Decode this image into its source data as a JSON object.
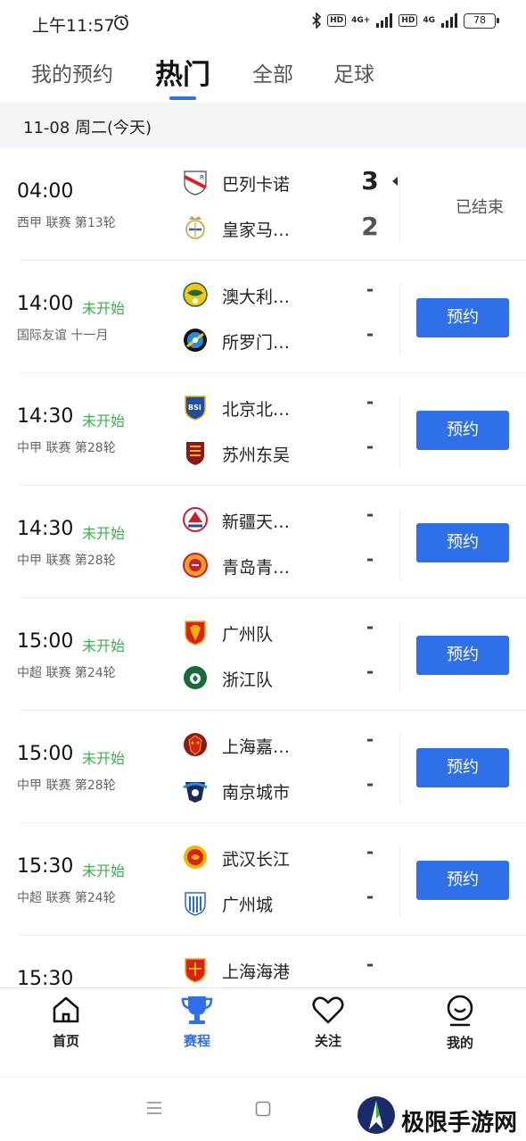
{
  "status_bar": {
    "time": "上午11:57",
    "net1": "4G+",
    "net2": "4G",
    "hd": "HD",
    "battery": "78"
  },
  "tabs": [
    {
      "label": "我的预约",
      "active": false
    },
    {
      "label": "热门",
      "active": true
    },
    {
      "label": "全部",
      "active": false
    },
    {
      "label": "足球",
      "active": false
    }
  ],
  "date_header": "11-08 周二(今天)",
  "matches": [
    {
      "time": "04:00",
      "state": "",
      "league": "西甲 联赛  第13轮",
      "home": "巴列卡诺",
      "away": "皇家马…",
      "home_score": "3",
      "away_score": "2",
      "action": "已结束",
      "home_logo": "rayo-logo",
      "away_logo": "real-madrid-logo"
    },
    {
      "time": "14:00",
      "state": "未开始",
      "league": "国际友谊 十一月",
      "home": "澳大利…",
      "away": "所罗门…",
      "home_score": "-",
      "away_score": "-",
      "action": "预约",
      "home_logo": "australia-logo",
      "away_logo": "solomon-logo"
    },
    {
      "time": "14:30",
      "state": "未开始",
      "league": "中甲 联赛  第28轮",
      "home": "北京北…",
      "away": "苏州东吴",
      "home_score": "-",
      "away_score": "-",
      "action": "预约",
      "home_logo": "beijing-logo",
      "away_logo": "suzhou-logo"
    },
    {
      "time": "14:30",
      "state": "未开始",
      "league": "中甲 联赛  第28轮",
      "home": "新疆天…",
      "away": "青岛青…",
      "home_score": "-",
      "away_score": "-",
      "action": "预约",
      "home_logo": "xinjiang-logo",
      "away_logo": "qingdao-logo"
    },
    {
      "time": "15:00",
      "state": "未开始",
      "league": "中超 联赛  第24轮",
      "home": "广州队",
      "away": "浙江队",
      "home_score": "-",
      "away_score": "-",
      "action": "预约",
      "home_logo": "guangzhou-logo",
      "away_logo": "zhejiang-logo"
    },
    {
      "time": "15:00",
      "state": "未开始",
      "league": "中甲 联赛  第28轮",
      "home": "上海嘉…",
      "away": "南京城市",
      "home_score": "-",
      "away_score": "-",
      "action": "预约",
      "home_logo": "shanghai-jiading-logo",
      "away_logo": "nanjing-logo"
    },
    {
      "time": "15:30",
      "state": "未开始",
      "league": "中超 联赛  第24轮",
      "home": "武汉长江",
      "away": "广州城",
      "home_score": "-",
      "away_score": "-",
      "action": "预约",
      "home_logo": "wuhan-logo",
      "away_logo": "guangzhou-city-logo"
    },
    {
      "time": "15:30",
      "state": "",
      "league": "",
      "home": "上海海港",
      "away": "",
      "home_score": "-",
      "away_score": "",
      "action": "",
      "home_logo": "shanghai-port-logo",
      "away_logo": ""
    }
  ],
  "bottom_nav": [
    {
      "label": "首页",
      "icon": "home-icon",
      "active": false
    },
    {
      "label": "赛程",
      "icon": "trophy-icon",
      "active": true
    },
    {
      "label": "关注",
      "icon": "heart-icon",
      "active": false
    },
    {
      "label": "我的",
      "icon": "profile-icon",
      "active": false
    }
  ],
  "watermark": "极限手游网",
  "colors": {
    "accent": "#2f6fe8",
    "not_started": "#3bb04a"
  }
}
